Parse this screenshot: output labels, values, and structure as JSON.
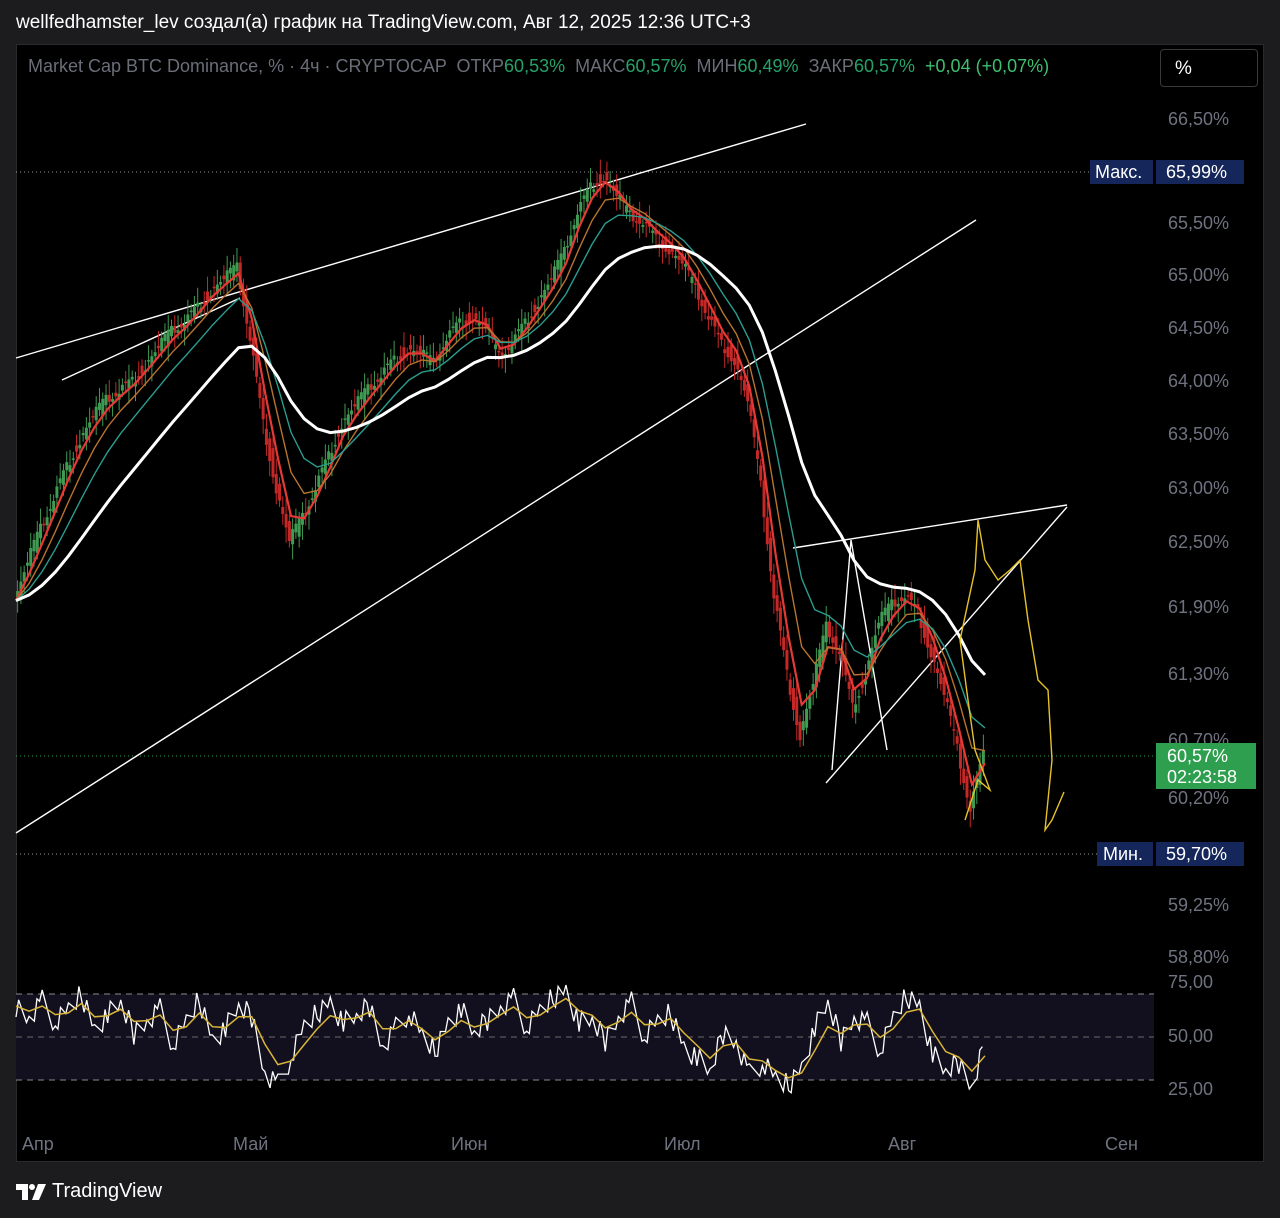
{
  "header": {
    "text": "wellfedhamster_lev создал(а) график на TradingView.com, Авг 12, 2025 12:36 UTC+3"
  },
  "legend": {
    "symbol": "Market Cap BTC Dominance, % · 4ч · CRYPTOCAP",
    "open_label": "ОТКР",
    "open_value": "60,53%",
    "high_label": "МАКС",
    "high_value": "60,57%",
    "low_label": "МИН",
    "low_value": "60,49%",
    "close_label": "ЗАКР",
    "close_value": "60,57%",
    "change": "+0,04 (+0,07%)"
  },
  "scale_mode_button": "%",
  "brand": {
    "name": "TradingView"
  },
  "colors": {
    "bull": "#3f9a52",
    "bear": "#c62828",
    "ema_fast": "#e53935",
    "ema_mid": "#b8732e",
    "ema_slow": "#2a9d8f",
    "ma_white": "#ffffff",
    "projection": "#e6c229",
    "rsi_line": "#ffffff",
    "rsi_ma": "#d9b53a",
    "price_tag": "#2e9e4f",
    "marker_tag": "#15275a"
  },
  "chart_data": [
    {
      "type": "line",
      "title": "Market Cap BTC Dominance, %",
      "timeframe": "4ч",
      "x_ticks": [
        "Апр",
        "Май",
        "Июн",
        "Июл",
        "Авг",
        "Сен"
      ],
      "y_ticks": [
        "66,50%",
        "65,50%",
        "65,00%",
        "64,50%",
        "64,00%",
        "63,50%",
        "63,00%",
        "62,50%",
        "61,90%",
        "61,30%",
        "60,70%",
        "60,20%",
        "59,25%",
        "58,80%"
      ],
      "ylim": [
        58.8,
        66.6
      ],
      "markers": [
        {
          "label": "Макс.",
          "value": "65,99%"
        },
        {
          "label": "Мин.",
          "value": "59,70%"
        }
      ],
      "last_price": {
        "value": "60,57%",
        "countdown": "02:23:58"
      },
      "series": [
        {
          "values": [
            61.95,
            62.3,
            62.6,
            62.9,
            63.2,
            63.45,
            63.65,
            63.8,
            63.9,
            64.0,
            64.15,
            64.3,
            64.45,
            64.55,
            64.7,
            64.85,
            64.95,
            65.05,
            64.4,
            63.6,
            63.0,
            62.5,
            62.7,
            63.0,
            63.3,
            63.6,
            63.75,
            63.9,
            64.05,
            64.2,
            64.3,
            64.25,
            64.15,
            64.4,
            64.55,
            64.6,
            64.5,
            64.2,
            64.35,
            64.55,
            64.75,
            64.95,
            65.2,
            65.6,
            65.85,
            65.95,
            65.75,
            65.55,
            65.5,
            65.35,
            65.25,
            65.1,
            64.85,
            64.6,
            64.35,
            64.2,
            63.8,
            63.0,
            62.0,
            61.3,
            60.75,
            61.2,
            61.7,
            61.5,
            61.0,
            61.3,
            61.75,
            61.9,
            62.0,
            61.85,
            61.5,
            61.1,
            60.6,
            60.1,
            60.57
          ]
        }
      ]
    },
    {
      "type": "line",
      "title": "",
      "y_ticks": [
        "75,00",
        "50,00",
        "25,00"
      ],
      "ylim": [
        20,
        80
      ],
      "series": [
        {
          "values": [
            68,
            62,
            71,
            58,
            65,
            75,
            54,
            63,
            70,
            52,
            60,
            66,
            45,
            58,
            72,
            48,
            55,
            68,
            62,
            30,
            22,
            38,
            55,
            64,
            70,
            58,
            62,
            68,
            45,
            55,
            64,
            50,
            42,
            58,
            66,
            52,
            60,
            68,
            72,
            55,
            64,
            73,
            77,
            58,
            60,
            48,
            62,
            70,
            50,
            58,
            64,
            44,
            38,
            30,
            52,
            48,
            28,
            35,
            25,
            22,
            32,
            55,
            70,
            48,
            62,
            58,
            42,
            60,
            74,
            68,
            40,
            30,
            35,
            22,
            48
          ]
        }
      ]
    }
  ]
}
